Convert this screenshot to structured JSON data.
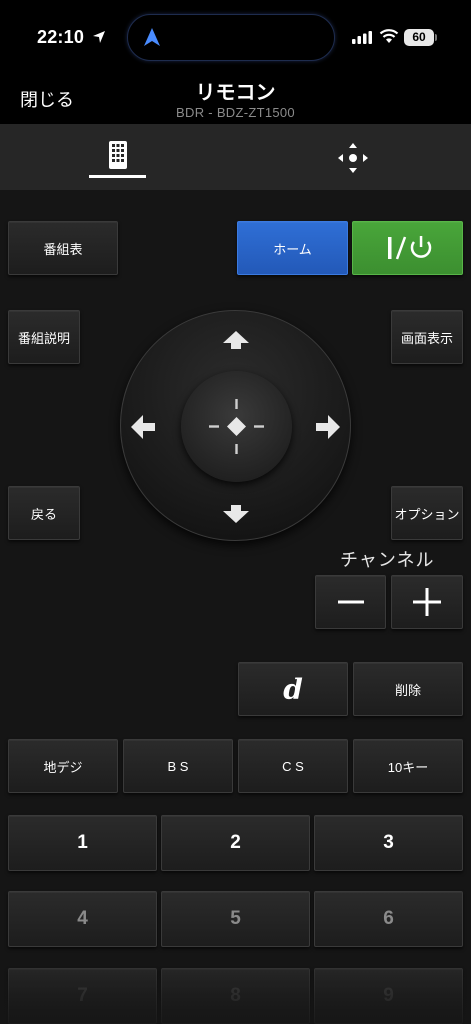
{
  "status": {
    "time": "22:10",
    "battery": "60"
  },
  "header": {
    "close": "閉じる",
    "title": "リモコン",
    "subtitle": "BDR - BDZ-ZT1500"
  },
  "buttons": {
    "epg": "番組表",
    "home": "ホーム",
    "power": "I/⏻",
    "program_info": "番組説明",
    "display": "画面表示",
    "back": "戻る",
    "options": "オプション",
    "channel_label": "チャンネル",
    "channel_minus": "−",
    "channel_plus": "+",
    "d_button": "d",
    "delete": "削除",
    "terrestrial": "地デジ",
    "bs": "B S",
    "cs": "C S",
    "ten_key": "10キー"
  },
  "numpad": [
    "1",
    "2",
    "3",
    "4",
    "5",
    "6",
    "7",
    "8",
    "9"
  ],
  "colors": {
    "home": "#2f6fd6",
    "power": "#49a63a",
    "background": "#151515"
  },
  "icons": {
    "tab_remote": "remote-grid-icon",
    "tab_dpad": "dpad-icon"
  }
}
